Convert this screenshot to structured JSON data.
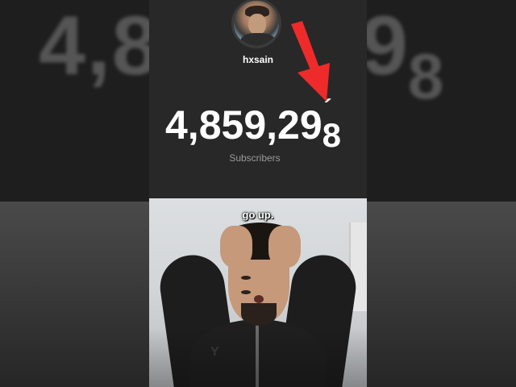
{
  "background": {
    "blurred_count_left": "4,8",
    "blurred_count_right": "9",
    "blurred_count_right_digit": "8"
  },
  "card": {
    "username": "hxsain",
    "count_main": "4,859,29",
    "count_last_digit": "8",
    "count_partial_digit": "´",
    "label": "Subscribers",
    "card_color": "#282828",
    "arrow_color": "#ef2a2a"
  },
  "video": {
    "caption": "go up.",
    "hoodie_logo": "Y"
  }
}
